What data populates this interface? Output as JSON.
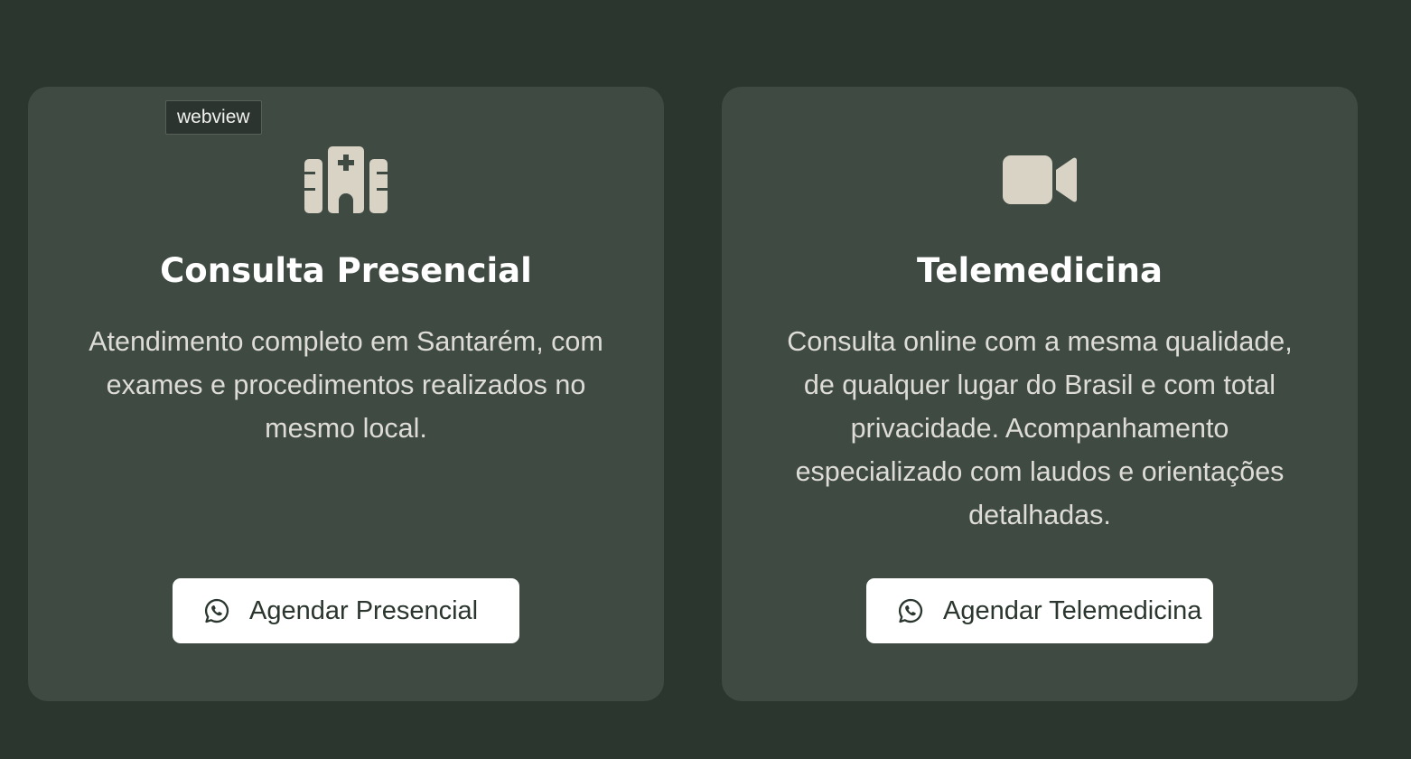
{
  "tooltip": {
    "label": "webview"
  },
  "cards": [
    {
      "icon": "hospital-icon",
      "title": "Consulta Presencial",
      "description": "Atendimento completo em Santarém, com exames e procedimentos realizados no mesmo local.",
      "button": {
        "icon": "whatsapp-icon",
        "label": "Agendar Presencial"
      }
    },
    {
      "icon": "video-camera-icon",
      "title": "Telemedicina",
      "description": "Consulta online com a mesma qualidade, de qualquer lugar do Brasil e com total privacidade. Acompanhamento especializado com laudos e orientações detalhadas.",
      "button": {
        "icon": "whatsapp-icon",
        "label": "Agendar Telemedicina"
      }
    }
  ],
  "colors": {
    "page_background": "#2a362e",
    "card_background": "#3f4a43",
    "icon_color": "#d8d3c5",
    "title_color": "#ffffff",
    "text_color": "#dedcd6",
    "button_background": "#ffffff",
    "button_text": "#2a362e"
  }
}
